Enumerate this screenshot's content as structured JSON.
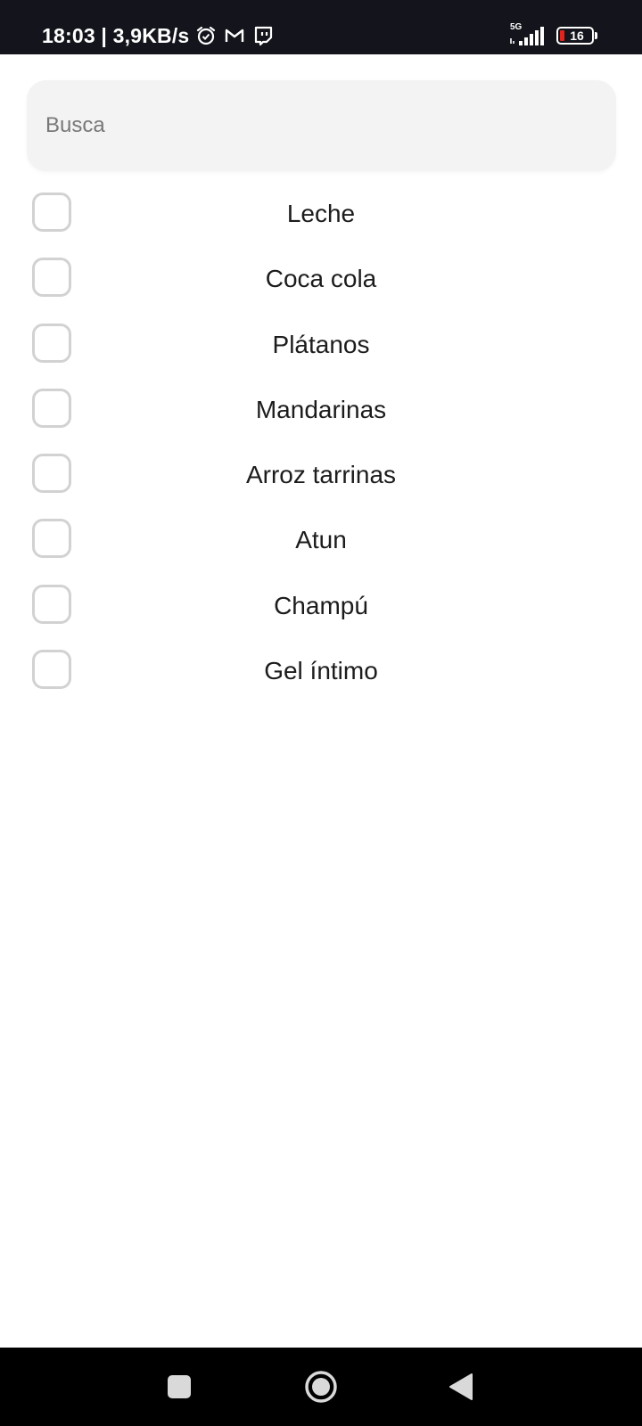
{
  "status_bar": {
    "time_speed": "18:03 | 3,9KB/s",
    "icons": [
      "alarm-icon",
      "gmail-icon",
      "twitch-icon"
    ],
    "network": "5G",
    "battery_level": "16",
    "battery_fraction": 0.16,
    "battery_color": "#e0251e"
  },
  "search": {
    "placeholder": "Busca",
    "value": ""
  },
  "items": [
    {
      "label": "Leche",
      "checked": false
    },
    {
      "label": "Coca cola",
      "checked": false
    },
    {
      "label": "Plátanos",
      "checked": false
    },
    {
      "label": "Mandarinas",
      "checked": false
    },
    {
      "label": "Arroz tarrinas",
      "checked": false
    },
    {
      "label": "Atun",
      "checked": false
    },
    {
      "label": "Champú",
      "checked": false
    },
    {
      "label": "Gel íntimo",
      "checked": false
    }
  ],
  "nav_bar": {
    "buttons": [
      "recents-icon",
      "home-icon",
      "back-icon"
    ]
  }
}
